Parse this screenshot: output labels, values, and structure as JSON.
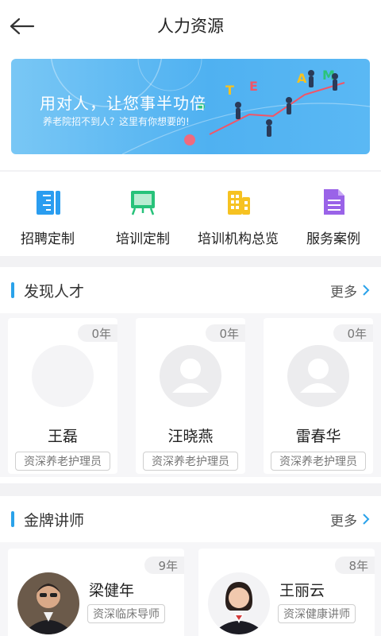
{
  "header": {
    "title": "人力资源",
    "back_icon": "back-arrow-icon"
  },
  "banner": {
    "headline": "用对人，让您事半功倍",
    "subline": "养老院招不到人？这里有你想要的!",
    "team_letters": [
      "T",
      "E",
      "A",
      "M"
    ]
  },
  "menu": [
    {
      "label": "招聘定制",
      "icon": "ruler-pencil-icon",
      "color": "#2a9df0"
    },
    {
      "label": "培训定制",
      "icon": "easel-board-icon",
      "color": "#27c27a"
    },
    {
      "label": "培训机构总览",
      "icon": "building-icon",
      "color": "#f6c221"
    },
    {
      "label": "服务案例",
      "icon": "document-icon",
      "color": "#9a63e8"
    }
  ],
  "talent": {
    "title": "发现人才",
    "more": "更多",
    "cards": [
      {
        "years": "0年",
        "name": "王磊",
        "tag": "资深养老护理员"
      },
      {
        "years": "0年",
        "name": "汪晓燕",
        "tag": "资深养老护理员"
      },
      {
        "years": "0年",
        "name": "雷春华",
        "tag": "资深养老护理员"
      }
    ]
  },
  "lecturers": {
    "title": "金牌讲师",
    "more": "更多",
    "cards": [
      {
        "years": "9年",
        "name": "梁健年",
        "tag": "资深临床导师"
      },
      {
        "years": "8年",
        "name": "王丽云",
        "tag": "资深健康讲师"
      }
    ]
  },
  "colors": {
    "accent": "#2aa2ea",
    "banner": "#4fb1f1"
  }
}
